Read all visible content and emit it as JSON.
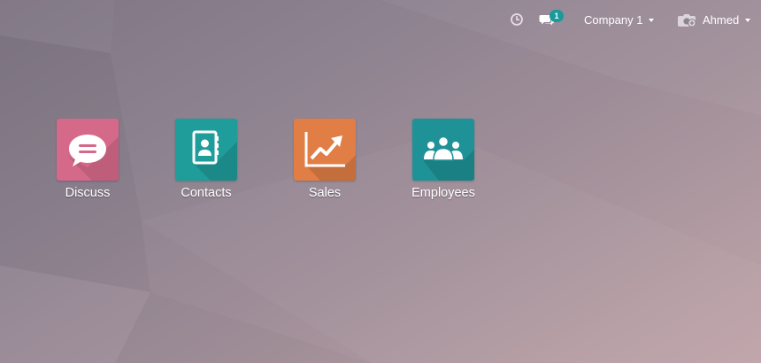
{
  "topbar": {
    "activity_icon": "clock-icon",
    "messages_icon": "chat-bubbles-icon",
    "messages_count": "1",
    "company_label": "Company 1",
    "user_icon": "camera-icon",
    "user_name": "Ahmed"
  },
  "apps": [
    {
      "label": "Discuss",
      "icon": "speech-bubble-icon",
      "color": "#d4698a"
    },
    {
      "label": "Contacts",
      "icon": "address-book-icon",
      "color": "#1f9d9a"
    },
    {
      "label": "Sales",
      "icon": "trending-chart-icon",
      "color": "#e07e45"
    },
    {
      "label": "Employees",
      "icon": "people-group-icon",
      "color": "#1f9297"
    }
  ],
  "colors": {
    "badge": "#1a9a9a",
    "text": "#ffffff"
  }
}
